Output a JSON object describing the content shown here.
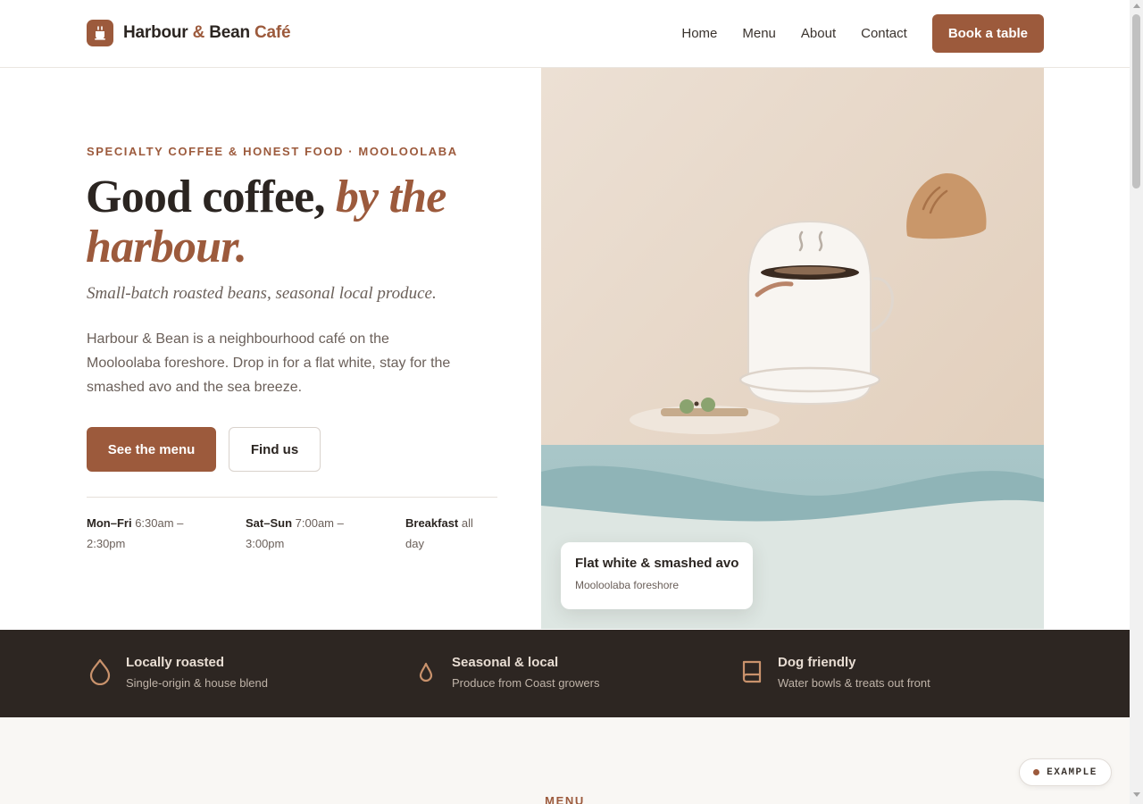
{
  "header": {
    "brand_part1": "Harbour",
    "brand_amp": "&",
    "brand_part2": "Bean",
    "brand_part3": "Café",
    "logo_icon": "coffee-cup-icon",
    "nav": [
      "Home",
      "Menu",
      "About",
      "Contact"
    ],
    "cta_label": "Book a table"
  },
  "hero": {
    "eyebrow": "SPECIALTY COFFEE & HONEST FOOD · MOOLOOLABA",
    "headline_plain": "Good coffee,",
    "headline_accent": "by the harbour.",
    "tagline": "Small-batch roasted beans, seasonal local produce.",
    "intro": "Harbour & Bean is a neighbourhood café on the Mooloolaba foreshore. Drop in for a flat white, stay for the smashed avo and the sea breeze.",
    "primary_button": "See the menu",
    "secondary_button": "Find us",
    "hours": [
      {
        "label": "Mon–Fri",
        "value": "6:30am – 2:30pm"
      },
      {
        "label": "Sat–Sun",
        "value": "7:00am – 3:00pm"
      },
      {
        "label": "Breakfast",
        "value": "all day"
      }
    ],
    "caption_title": "Flat white & smashed avo",
    "caption_sub": "Mooloolaba foreshore"
  },
  "features": [
    {
      "icon": "droplet-icon",
      "title": "Locally roasted",
      "sub": "Single-origin & house blend"
    },
    {
      "icon": "drop-icon",
      "title": "Seasonal & local",
      "sub": "Produce from Coast growers"
    },
    {
      "icon": "book-icon",
      "title": "Dog friendly",
      "sub": "Water bowls & treats out front"
    }
  ],
  "menu_section": {
    "label": "MENU"
  },
  "badge": {
    "label": "EXAMPLE"
  },
  "colors": {
    "accent": "#9c5a3c",
    "dark": "#2d2622",
    "text": "#2b2521",
    "muted": "#6b605a"
  }
}
